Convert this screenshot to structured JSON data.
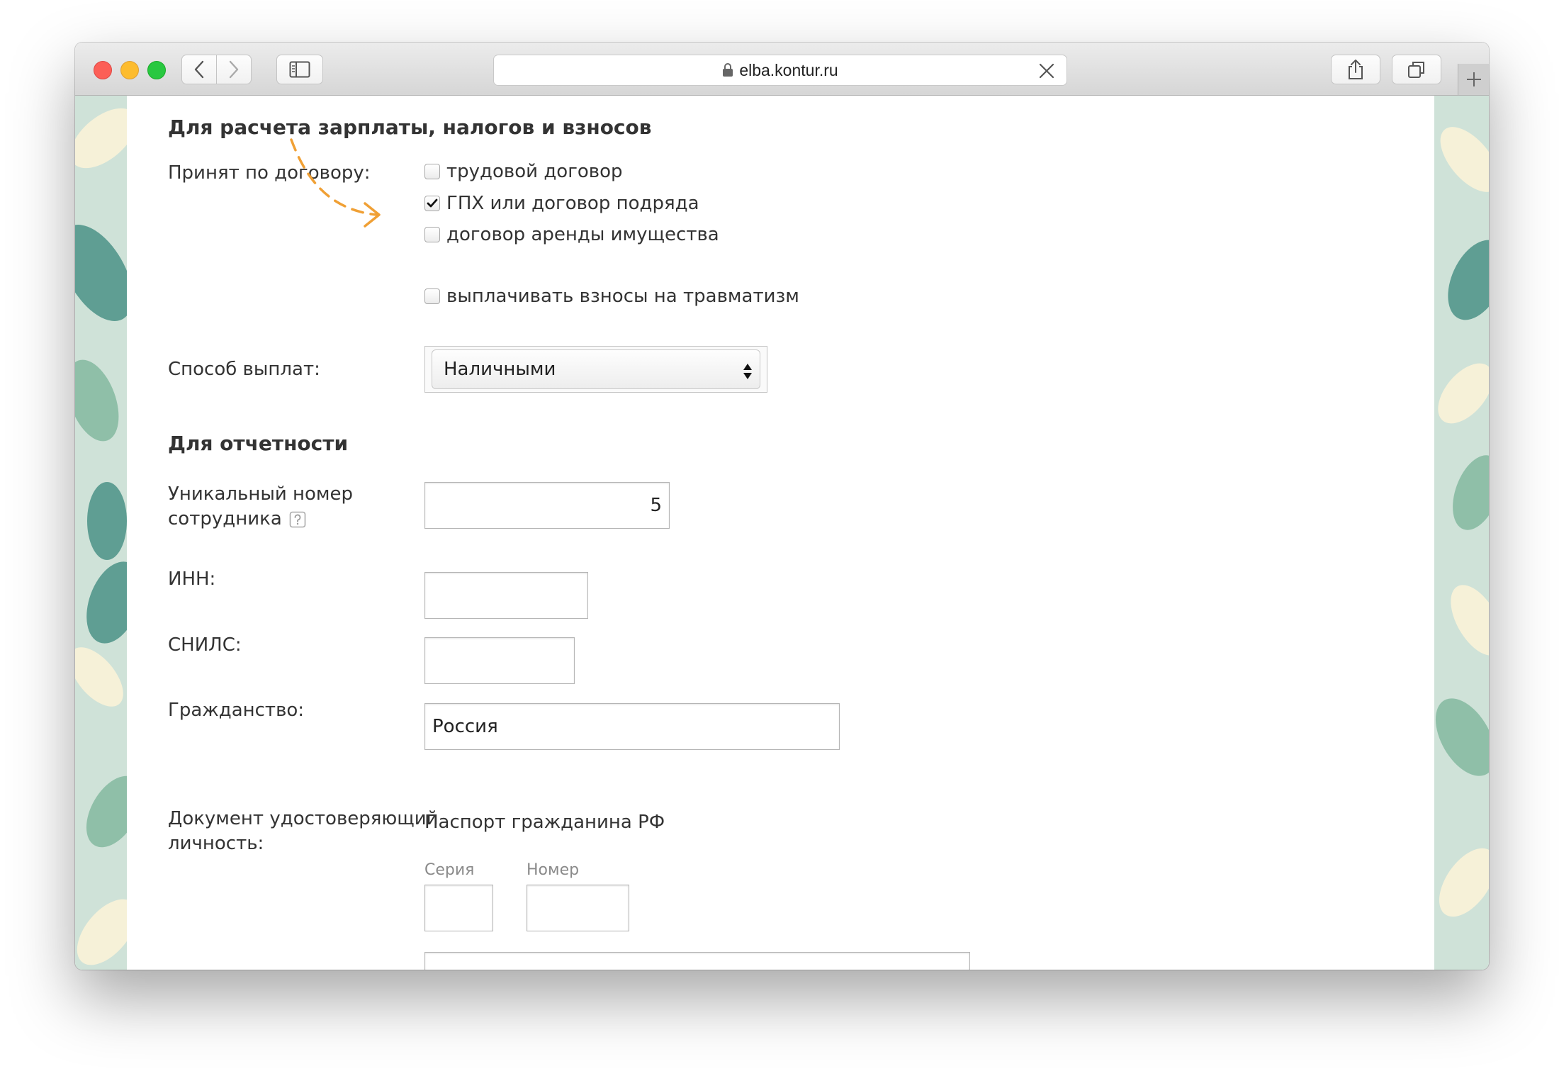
{
  "browser": {
    "url": "elba.kontur.ru"
  },
  "form": {
    "section_salary": "Для расчета зарплаты, налогов и взносов",
    "contract_label": "Принят по договору:",
    "contract_options": [
      {
        "label": "трудовой договор",
        "checked": false
      },
      {
        "label": "ГПХ или договор подряда",
        "checked": true
      },
      {
        "label": "договор аренды имущества",
        "checked": false
      }
    ],
    "injury_contrib": {
      "label": "выплачивать взносы на травматизм",
      "checked": false
    },
    "payment_method_label": "Способ выплат:",
    "payment_method_value": "Наличными",
    "section_reporting": "Для отчетности",
    "employee_number_label_1": "Уникальный номер",
    "employee_number_label_2": "сотрудника",
    "employee_number_value": "5",
    "inn_label": "ИНН:",
    "inn_value": "",
    "snils_label": "СНИЛС:",
    "snils_value": "",
    "citizenship_label": "Гражданство:",
    "citizenship_value": "Россия",
    "id_doc_label_1": "Документ удостоверяющий",
    "id_doc_label_2": "личность:",
    "id_doc_value": "Паспорт гражданина РФ",
    "series_label": "Серия",
    "series_value": "",
    "number_label": "Номер",
    "number_value": ""
  },
  "colors": {
    "annotation_arrow": "#f0a035",
    "close": "#fc5f57",
    "minimize": "#fdbc2e",
    "maximize": "#28c840"
  },
  "icons": [
    "lock-icon",
    "clear-url-icon",
    "back-icon",
    "forward-icon",
    "sidebar-icon",
    "share-icon",
    "tabs-icon",
    "plus-icon",
    "help-icon",
    "checkmark-icon",
    "select-arrows-icon"
  ]
}
